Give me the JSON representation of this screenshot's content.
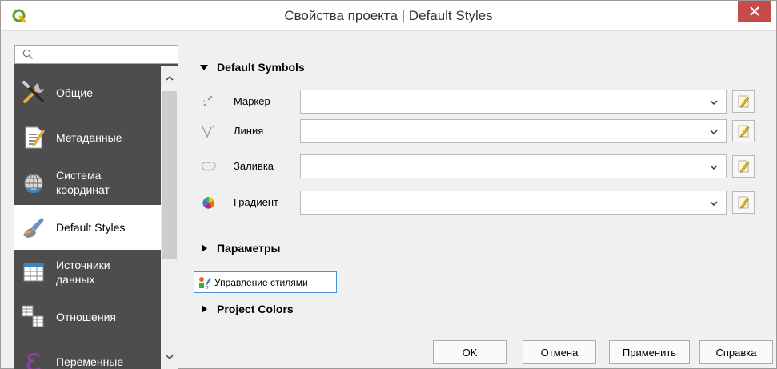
{
  "window": {
    "title": "Свойства проекта | Default Styles"
  },
  "search": {
    "placeholder": "",
    "value": ""
  },
  "sidebar": {
    "items": [
      {
        "label": "Общие",
        "icon": "tools-icon",
        "active": false
      },
      {
        "label": "Метаданные",
        "icon": "metadata-icon",
        "active": false
      },
      {
        "label": "Система\nкоординат",
        "icon": "globe-icon",
        "active": false
      },
      {
        "label": "Default Styles",
        "icon": "paintbrush-icon",
        "active": true
      },
      {
        "label": "Источники\nданных",
        "icon": "table-icon",
        "active": false
      },
      {
        "label": "Отношения",
        "icon": "relations-icon",
        "active": false
      },
      {
        "label": "Переменные",
        "icon": "epsilon-icon",
        "active": false
      }
    ]
  },
  "default_symbols": {
    "header": "Default Symbols",
    "rows": [
      {
        "label": "Маркер",
        "icon": "marker-icon",
        "value": ""
      },
      {
        "label": "Линия",
        "icon": "line-icon",
        "value": ""
      },
      {
        "label": "Заливка",
        "icon": "fill-icon",
        "value": ""
      },
      {
        "label": "Градиент",
        "icon": "gradient-icon",
        "value": ""
      }
    ]
  },
  "parameters": {
    "header": "Параметры"
  },
  "style_manager": {
    "label": "Управление стилями"
  },
  "project_colors": {
    "header": "Project Colors"
  },
  "buttons": {
    "ok": "OK",
    "cancel": "Отмена",
    "apply": "Применить",
    "help": "Справка"
  },
  "colors": {
    "sidebar_bg": "#4d4d4d",
    "close_bg": "#c84b4b",
    "focus_border": "#4a90d9"
  }
}
